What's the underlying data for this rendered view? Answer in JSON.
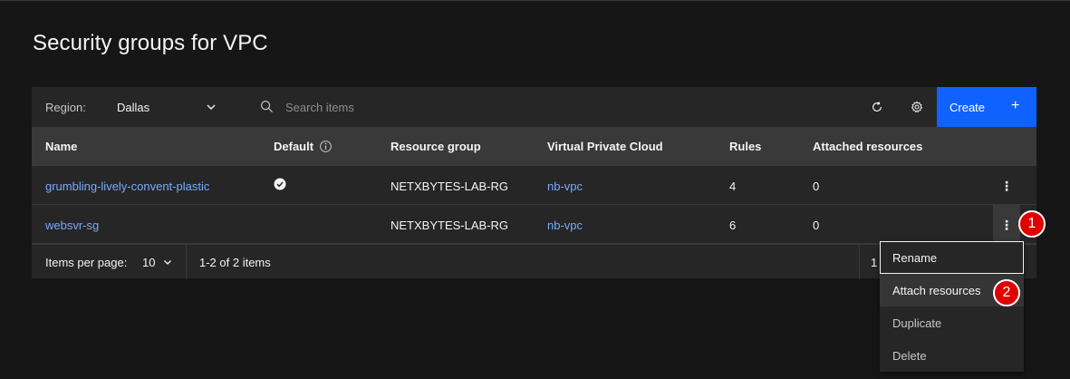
{
  "page": {
    "title": "Security groups for VPC"
  },
  "toolbar": {
    "region_label": "Region:",
    "region_value": "Dallas",
    "search_placeholder": "Search items",
    "create_label": "Create",
    "create_plus": "+"
  },
  "table": {
    "columns": [
      "Name",
      "Default",
      "Resource group",
      "Virtual Private Cloud",
      "Rules",
      "Attached resources"
    ],
    "rows": [
      {
        "name": "grumbling-lively-convent-plastic",
        "default": true,
        "resource_group": "NETXBYTES-LAB-RG",
        "vpc": "nb-vpc",
        "rules": "4",
        "attached": "0"
      },
      {
        "name": "websvr-sg",
        "default": false,
        "resource_group": "NETXBYTES-LAB-RG",
        "vpc": "nb-vpc",
        "rules": "6",
        "attached": "0"
      }
    ],
    "overflow_glyph": "⋮"
  },
  "pagination": {
    "items_per_page_label": "Items per page:",
    "items_per_page_value": "10",
    "range_text": "1-2 of 2 items",
    "page_number": "1"
  },
  "overflow_menu": {
    "items": [
      "Rename",
      "Attach resources",
      "Duplicate",
      "Delete"
    ]
  },
  "annotations": {
    "step1": "1",
    "step2": "2"
  },
  "colors": {
    "accent": "#0f62fe",
    "link": "#78a9ff",
    "badge": "#e00000",
    "background": "#161616"
  }
}
